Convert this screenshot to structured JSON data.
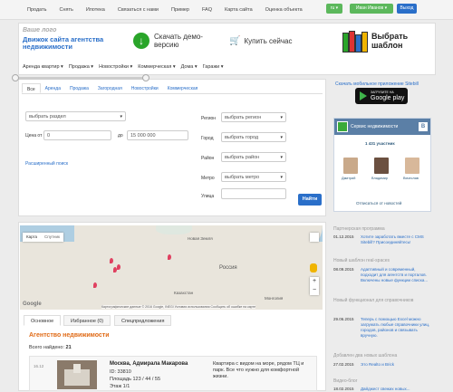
{
  "topbar": {
    "nav": [
      "Продать",
      "Снять",
      "Ипотека",
      "Связаться с нами",
      "Пример",
      "FAQ",
      "Карта сайта",
      "Оценка объекта"
    ],
    "lang": "ru ▾",
    "user": "Иван Иванов ▾",
    "logout": "Выход"
  },
  "header": {
    "logo_small": "Ваше лого",
    "logo_main": "Движок сайта агентства недвижимости",
    "download": "Скачать демо-версию",
    "buy": "Купить сейчас",
    "choose": "Выбрать шаблон",
    "nav": [
      "Аренда квартир ▾",
      "Продажа ▾",
      "Новостройки ▾",
      "Коммерческая ▾",
      "Дома ▾",
      "Гаражи ▾"
    ]
  },
  "search": {
    "tabs": [
      "Все",
      "Аренда",
      "Продажа",
      "Загородная",
      "Новостройки",
      "Коммерческая"
    ],
    "section_placeholder": "выбрать раздел",
    "price_from_label": "Цена от",
    "price_from": "0",
    "price_to_label": "до",
    "price_to": "15 000 000",
    "advanced": "Расширенный поиск",
    "region_label": "Регион",
    "region": "выбрать регион",
    "city_label": "Город",
    "city": "выбрать город",
    "district_label": "Район",
    "district": "выбрать район",
    "metro_label": "Метро",
    "metro": "выбрать метро",
    "street_label": "Улица",
    "submit": "Найти"
  },
  "sidebar": {
    "mobile_link": "Скачать мобильное приложение Sitebill",
    "gplay_small": "ЗАГРУЗИТЕ НА",
    "gplay_large": "Google play",
    "vk_title": "Сервис недвижимости",
    "vk_count": "1 431 участник",
    "vk_members": [
      "Дмитрий",
      "Владимир",
      "Вячеслав"
    ],
    "vk_unsub": "Отписаться от новостей",
    "partner_head": "Партнерская программа",
    "partner_date": "01.12.2015",
    "partner_text": "Хотите заработать вместе с CMS Sitebill? Присоединяйтесь!",
    "template_head": "Новый шаблон real-spaces",
    "template_date": "08.09.2015",
    "template_text": "Адаптивный и современный, подходит для агентств и порталов. Включены новые функции списка...",
    "dir_head": "Новый функционал для справочников",
    "dir_date": "29.06.2015",
    "dir_text": "Теперь с помощью Excel можно загружать любые справочники улиц, городов, районов и связывать вручную.",
    "reg_head": "Добавлен два новых шаблона",
    "reg_date": "27.02.2015",
    "reg_text": "Это Realto и Brick",
    "video_head": "Видео-блог",
    "video_date": "18.02.2015",
    "video_text": "Дайджест свежих новых..."
  },
  "map": {
    "type_map": "Карта",
    "type_sat": "Спутник",
    "copyright": "Картографические данные © 2016 Google, INEGI   Условия использования   Сообщить об ошибке на карте",
    "places": [
      "Новая Земля",
      "Россия",
      "Казахстан",
      "Монголия"
    ]
  },
  "results": {
    "tabs": [
      "Основное",
      "Избранное (0)",
      "Спецпредложения"
    ],
    "title": "Агентство недвижимости",
    "found_label": "Всего найдено:",
    "found_count": "21",
    "listing": {
      "date": "16.12",
      "address": "Москва, Адмирала Макарова",
      "id": "ID: 33810",
      "area": "Площадь 123 / 44 / 55",
      "floor": "Этаж 1/1",
      "desc": "Квартира с видом на море, рядом ТЦ и парк. Все что нужно для комфортной жизни."
    }
  }
}
